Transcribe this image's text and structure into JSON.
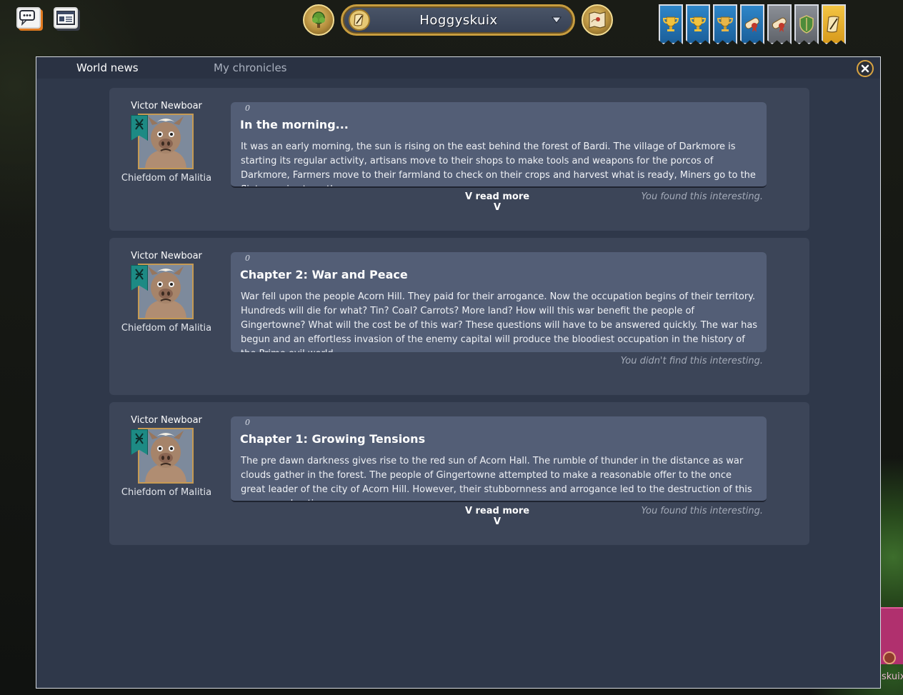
{
  "topbar": {
    "chat_icon": "chat-bubbles-icon",
    "news_icon": "newspaper-icon",
    "tree_icon": "tech-tree-icon",
    "realm_selector": {
      "icon": "scroll-quill-icon",
      "name": "Hoggyskuix",
      "arrow": "chevron-down-icon"
    },
    "map_icon": "map-scroll-icon",
    "achievements": [
      {
        "icon": "trophy-icon",
        "color": "#2e86c9"
      },
      {
        "icon": "trophy-icon",
        "color": "#2e86c9"
      },
      {
        "icon": "trophy-icon",
        "color": "#2e86c9"
      },
      {
        "icon": "diploma-icon",
        "color": "#2e86c9"
      },
      {
        "icon": "diploma-icon",
        "color": "#8b8f96"
      },
      {
        "icon": "shield-icon",
        "color": "#8b8f96"
      },
      {
        "icon": "scroll-quill-icon",
        "color": "#f3c544"
      }
    ]
  },
  "panel": {
    "tabs": [
      "World news",
      "My chronicles"
    ],
    "close_icon": "close-icon",
    "entries": [
      {
        "author": "Victor Newboar",
        "realm": "Chiefdom of Malitia",
        "count": "0",
        "title": "In the morning...",
        "body": "It was an early morning, the sun is rising on the east behind the forest of Bardi. The village of Darkmore is starting its regular activity, artisans move to their shops to make tools and weapons for the porcos of Darkmore, Farmers move to their farmland to check on their crops and harvest what is ready, Miners go to the flint quarries to gather up any",
        "read_more": "V  read more  V",
        "interest": "You found this interesting."
      },
      {
        "author": "Victor Newboar",
        "realm": "Chiefdom of Malitia",
        "count": "0",
        "title": "Chapter 2: War and Peace",
        "body": "War fell upon the people Acorn Hill. They paid for their arrogance. Now the occupation begins of their territory. Hundreds will die for what? Tin? Coal? Carrots? More land? How will this war benefit the people of Gingertowne? What will the cost be of this war? These questions will have to be answered quickly. The war has begun and an effortless invasion of the enemy capital  will produce the bloodiest occupation in the history of the Prime evil world.",
        "read_more": "",
        "interest": "You didn't find this interesting."
      },
      {
        "author": "Victor Newboar",
        "realm": "Chiefdom of Malitia",
        "count": "0",
        "title": "Chapter 1: Growing Tensions",
        "body": "The pre dawn darkness gives rise to the red sun of Acorn Hall. The rumble of thunder in the distance as war clouds gather in the forest. The people of Gingertowne attempted to make a reasonable offer  to the once great leader of the city of Acorn Hill. However, their  stubbornness and arrogance led to the destruction of this once proud nation.",
        "read_more": "V  read more  V",
        "interest": "You found this interesting."
      }
    ]
  },
  "map_fragment": {
    "label": "skuix"
  }
}
